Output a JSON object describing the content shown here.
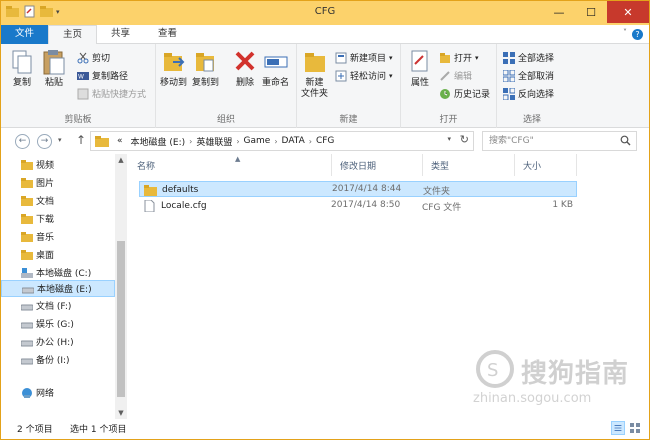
{
  "window": {
    "title": "CFG",
    "controls": [
      "—",
      "☐",
      "✕"
    ],
    "accent": "#1979ca",
    "titlebar_color": "#fcd26b"
  },
  "ribbon_tabs": [
    "文件",
    "主页",
    "共享",
    "查看"
  ],
  "ribbon": {
    "clipboard": {
      "label": "剪贴板",
      "copy": "复制",
      "paste": "粘贴",
      "cut": "剪切",
      "copy_path": "复制路径",
      "paste_shortcut": "粘贴快捷方式"
    },
    "organize": {
      "label": "组织",
      "move_to": "移动到",
      "copy_to": "复制到",
      "delete": "删除",
      "rename": "重命名"
    },
    "new": {
      "label": "新建",
      "new_folder_line1": "新建",
      "new_folder_line2": "文件夹",
      "new_item": "新建项目",
      "easy_access": "轻松访问"
    },
    "open": {
      "label": "打开",
      "properties": "属性",
      "open": "打开",
      "edit": "编辑",
      "history": "历史记录"
    },
    "select": {
      "label": "选择",
      "select_all": "全部选择",
      "select_none": "全部取消",
      "invert": "反向选择"
    }
  },
  "address": {
    "crumbs": [
      "本地磁盘 (E:)",
      "英雄联盟",
      "Game",
      "DATA",
      "CFG"
    ],
    "overflow": "«",
    "search_placeholder": "搜索\"CFG\""
  },
  "nav_pane": [
    {
      "label": "视频",
      "icon": "video-folder-icon"
    },
    {
      "label": "图片",
      "icon": "pictures-folder-icon"
    },
    {
      "label": "文档",
      "icon": "documents-folder-icon"
    },
    {
      "label": "下载",
      "icon": "downloads-folder-icon"
    },
    {
      "label": "音乐",
      "icon": "music-folder-icon"
    },
    {
      "label": "桌面",
      "icon": "desktop-folder-icon"
    },
    {
      "label": "本地磁盘 (C:)",
      "icon": "system-drive-icon"
    },
    {
      "label": "本地磁盘 (E:)",
      "icon": "drive-icon",
      "selected": true
    },
    {
      "label": "文档 (F:)",
      "icon": "drive-icon"
    },
    {
      "label": "娱乐 (G:)",
      "icon": "drive-icon"
    },
    {
      "label": "办公 (H:)",
      "icon": "drive-icon"
    },
    {
      "label": "备份 (I:)",
      "icon": "drive-icon"
    },
    {
      "label": "网络",
      "icon": "network-icon"
    }
  ],
  "columns": {
    "name": "名称",
    "date": "修改日期",
    "type": "类型",
    "size": "大小"
  },
  "files": [
    {
      "name": "defaults",
      "date": "2017/4/14 8:44",
      "type": "文件夹",
      "size": "",
      "icon": "folder-icon",
      "selected": true
    },
    {
      "name": "Locale.cfg",
      "date": "2017/4/14 8:50",
      "type": "CFG 文件",
      "size": "1 KB",
      "icon": "file-icon",
      "selected": false
    }
  ],
  "status": {
    "count": "2 个项目",
    "selection": "选中 1 个项目"
  },
  "watermark": {
    "text": "搜狗指南",
    "url": "zhinan.sogou.com"
  }
}
